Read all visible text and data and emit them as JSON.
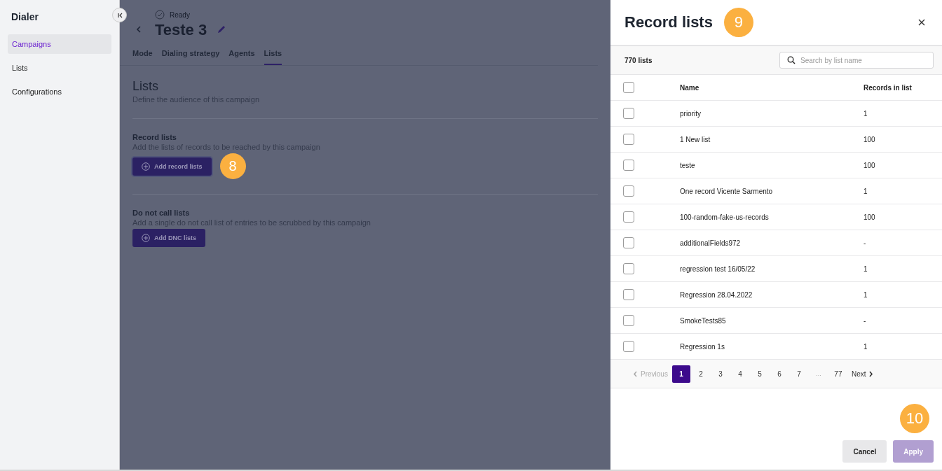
{
  "sidebar": {
    "title": "Dialer",
    "items": [
      {
        "label": "Campaigns",
        "selected": true
      },
      {
        "label": "Lists",
        "selected": false
      },
      {
        "label": "Configurations",
        "selected": false
      }
    ]
  },
  "page": {
    "status": "Ready",
    "title": "Teste 3",
    "tabs": [
      {
        "label": "Mode",
        "selected": false
      },
      {
        "label": "Dialing strategy",
        "selected": false
      },
      {
        "label": "Agents",
        "selected": false
      },
      {
        "label": "Lists",
        "selected": true
      }
    ],
    "heading": "Lists",
    "subheading": "Define the audience of this campaign",
    "groups": [
      {
        "title": "Record lists",
        "description": "Add the lists of records to be reached by this campaign",
        "button": "Add record lists",
        "focused": true,
        "callout": "8"
      },
      {
        "title": "Do not call lists",
        "description": "Add a single do not call list of entries to be scrubbed by this campaign",
        "button": "Add DNC lists",
        "focused": false
      }
    ]
  },
  "panel": {
    "title": "Record lists",
    "callout": "9",
    "count": "770 lists",
    "search": {
      "placeholder": "Search by list name"
    },
    "all_checked": false,
    "columns": [
      "Name",
      "Records in list"
    ],
    "rows": [
      {
        "name": "priority",
        "records": "1",
        "checked": false
      },
      {
        "name": "1 New list",
        "records": "100",
        "checked": false
      },
      {
        "name": "teste",
        "records": "100",
        "checked": false
      },
      {
        "name": "One record Vicente Sarmento",
        "records": "1",
        "checked": false
      },
      {
        "name": "100-random-fake-us-records",
        "records": "100",
        "checked": false
      },
      {
        "name": "additionalFields972",
        "records": "-",
        "checked": false
      },
      {
        "name": "regression test 16/05/22",
        "records": "1",
        "checked": false
      },
      {
        "name": "Regression 28.04.2022",
        "records": "1",
        "checked": false
      },
      {
        "name": "SmokeTests85",
        "records": "-",
        "checked": false
      },
      {
        "name": "Regression 1s",
        "records": "1",
        "checked": false
      }
    ],
    "pagination": {
      "previous": "Previous",
      "previous_disabled": true,
      "next": "Next",
      "pages": [
        {
          "label": "1",
          "kind": "page",
          "selected": true
        },
        {
          "label": "2",
          "kind": "page",
          "selected": false
        },
        {
          "label": "3",
          "kind": "page",
          "selected": false
        },
        {
          "label": "4",
          "kind": "page",
          "selected": false
        },
        {
          "label": "5",
          "kind": "page",
          "selected": false
        },
        {
          "label": "6",
          "kind": "page",
          "selected": false
        },
        {
          "label": "7",
          "kind": "page",
          "selected": false
        },
        {
          "label": "...",
          "kind": "ellipsis"
        },
        {
          "label": "77",
          "kind": "page",
          "selected": false
        }
      ]
    },
    "footer_callout": "10",
    "buttons": [
      {
        "label": "Cancel",
        "kind": "secondary",
        "disabled": false
      },
      {
        "label": "Apply",
        "kind": "primary",
        "disabled": true
      }
    ]
  }
}
